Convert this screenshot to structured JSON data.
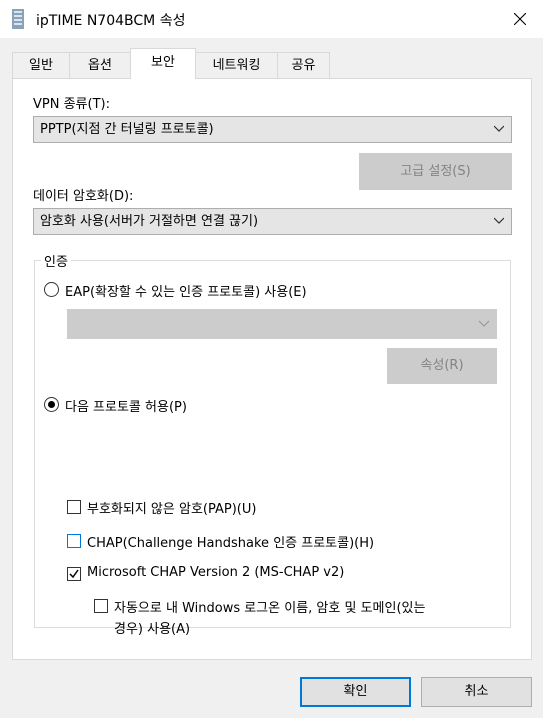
{
  "window": {
    "title": "ipTIME N704BCM 속성",
    "icon": "network-connection-icon",
    "close_icon": "close-icon"
  },
  "tabs": [
    {
      "label": "일반",
      "active": false
    },
    {
      "label": "옵션",
      "active": false
    },
    {
      "label": "보안",
      "active": true
    },
    {
      "label": "네트워킹",
      "active": false
    },
    {
      "label": "공유",
      "active": false
    }
  ],
  "security": {
    "vpn_type_label": "VPN 종류(T):",
    "vpn_type_value": "PPTP(지점 간 터널링 프로토콜)",
    "advanced_button": "고급 설정(S)",
    "encryption_label": "데이터 암호화(D):",
    "encryption_value": "암호화 사용(서버가 거절하면 연결 끊기)",
    "auth_group_label": "인증",
    "eap_radio_label": "EAP(확장할 수 있는 인증 프로토콜) 사용(E)",
    "eap_combo_value": "",
    "properties_button": "속성(R)",
    "allow_protocols_label": "다음 프로토콜 허용(P)",
    "pap_label": "부호화되지 않은 암호(PAP)(U)",
    "chap_label": "CHAP(Challenge Handshake 인증 프로토콜)(H)",
    "mschap_label": "Microsoft CHAP Version 2 (MS-CHAP v2)",
    "auto_logon_label_line1": "자동으로 내 Windows 로그온 이름, 암호 및 도메인(있는",
    "auto_logon_label_line2": "경우) 사용(A)"
  },
  "footer": {
    "ok_button": "확인",
    "cancel_button": "취소"
  },
  "state": {
    "eap_selected": false,
    "allow_protocols_selected": true,
    "pap_checked": false,
    "chap_checked": false,
    "mschap_checked": true,
    "auto_logon_checked": false
  },
  "colors": {
    "accent": "#0078d7",
    "disabled": "#838383"
  }
}
